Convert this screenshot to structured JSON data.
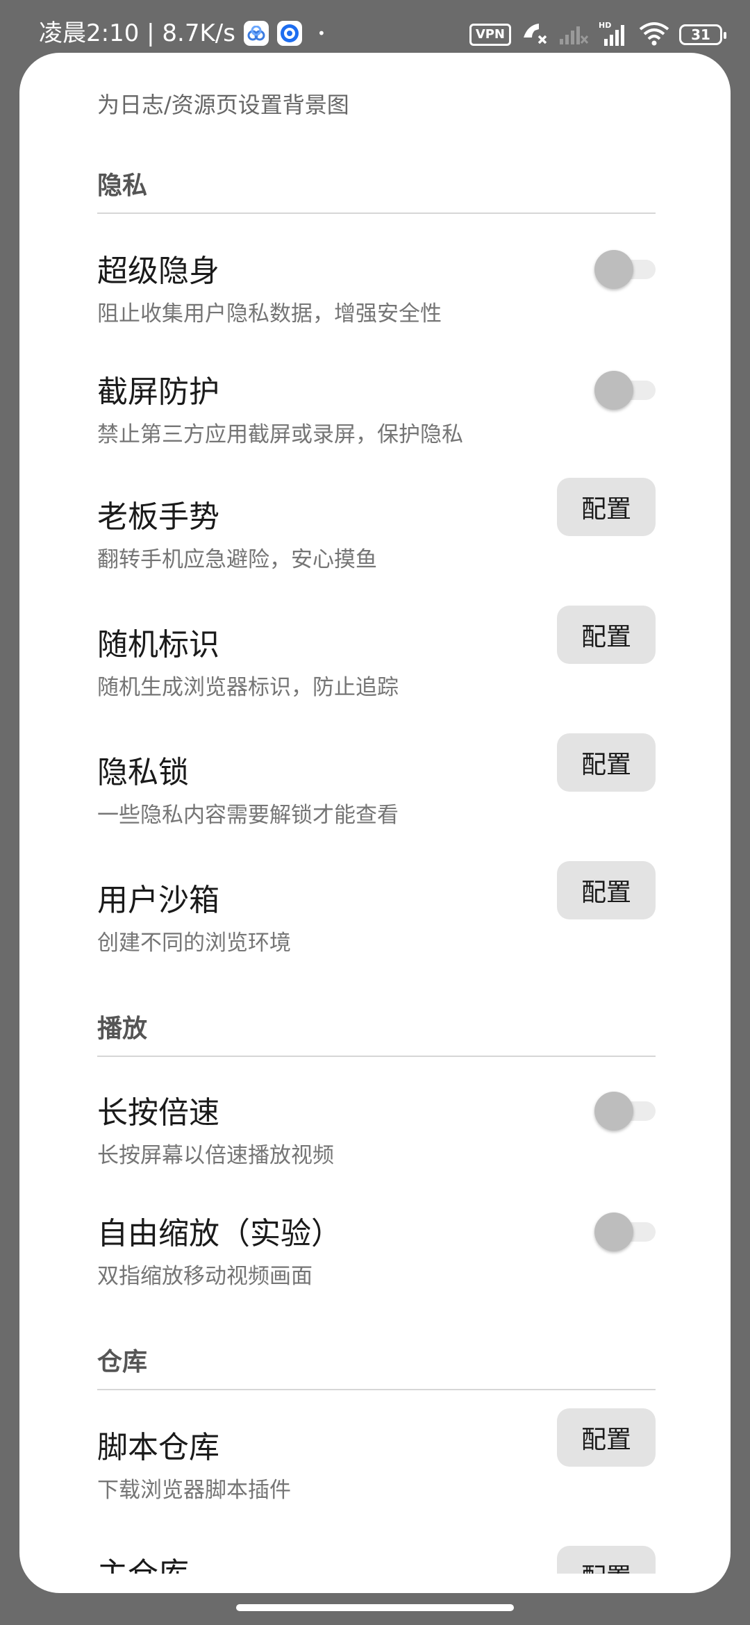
{
  "status_bar": {
    "time_speed": "凌晨2:10 | 8.7K/s",
    "dot": "•",
    "vpn": "VPN",
    "battery": "31",
    "icons": [
      "app-cloud-icon",
      "app-browser-icon",
      "phone-missed-icon",
      "signal-weak-icon",
      "signal-hd-icon",
      "wifi-icon",
      "battery-icon"
    ]
  },
  "intro": {
    "text": "为日志/资源页设置背景图"
  },
  "sections": {
    "privacy": {
      "title": "隐私",
      "items": [
        {
          "title": "超级隐身",
          "desc": "阻止收集用户隐私数据，增强安全性",
          "control": "toggle",
          "on": false
        },
        {
          "title": "截屏防护",
          "desc": "禁止第三方应用截屏或录屏，保护隐私",
          "control": "toggle",
          "on": false
        },
        {
          "title": "老板手势",
          "desc": "翻转手机应急避险，安心摸鱼",
          "control": "button",
          "button_label": "配置"
        },
        {
          "title": "随机标识",
          "desc": "随机生成浏览器标识，防止追踪",
          "control": "button",
          "button_label": "配置"
        },
        {
          "title": "隐私锁",
          "desc": "一些隐私内容需要解锁才能查看",
          "control": "button",
          "button_label": "配置"
        },
        {
          "title": "用户沙箱",
          "desc": "创建不同的浏览环境",
          "control": "button",
          "button_label": "配置"
        }
      ]
    },
    "playback": {
      "title": "播放",
      "items": [
        {
          "title": "长按倍速",
          "desc": "长按屏幕以倍速播放视频",
          "control": "toggle",
          "on": false
        },
        {
          "title": "自由缩放（实验）",
          "desc": "双指缩放移动视频画面",
          "control": "toggle",
          "on": false
        }
      ]
    },
    "repository": {
      "title": "仓库",
      "items": [
        {
          "title": "脚本仓库",
          "desc": "下载浏览器脚本插件",
          "control": "button",
          "button_label": "配置"
        },
        {
          "title": "主仓库",
          "control": "button",
          "button_label": "配置"
        }
      ]
    }
  },
  "colors": {
    "background_dim": "#6b6b6b",
    "sheet": "#ffffff",
    "button_bg": "#e3e3e3",
    "toggle_thumb_off": "#bdbdbd",
    "toggle_track_off": "#ececec"
  }
}
